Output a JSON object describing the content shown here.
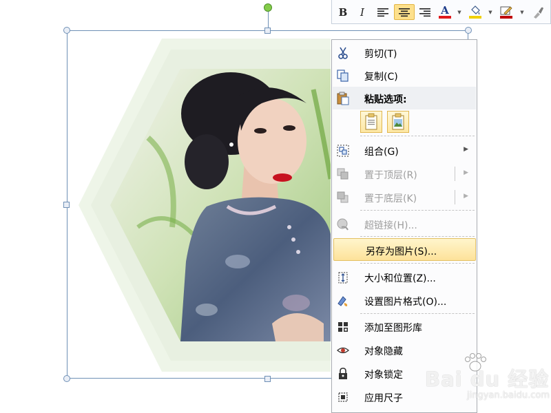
{
  "mini_toolbar": {
    "bold_label": "B",
    "italic_label": "I",
    "font_color_label": "A",
    "font_color": "#e0191c",
    "fill_color": "#f0d000",
    "outline_color": "#c00000",
    "icons": [
      "bold-icon",
      "italic-icon",
      "align-left-icon",
      "align-center-icon",
      "align-right-icon",
      "font-color-icon",
      "shape-fill-icon",
      "shape-outline-icon",
      "format-painter-icon"
    ]
  },
  "context_menu": {
    "cut": "剪切(T)",
    "copy": "复制(C)",
    "paste_options": "粘贴选项:",
    "group": "组合(G)",
    "bring_to_front": "置于顶层(R)",
    "send_to_back": "置于底层(K)",
    "hyperlink": "超链接(H)...",
    "save_as_picture": "另存为图片(S)...",
    "size_position": "大小和位置(Z)...",
    "format_picture": "设置图片格式(O)...",
    "add_to_gallery": "添加至图形库",
    "hide_object": "对象隐藏",
    "lock_object": "对象锁定",
    "apply_ruler": "应用尺子"
  },
  "watermark": {
    "brand": "Bai du 经验",
    "url": "jingyan.baidu.com"
  },
  "colors": {
    "selection_border": "#6e8fb5",
    "highlight_bg": "#fde29a",
    "rotation_handle": "#84cc4a"
  }
}
